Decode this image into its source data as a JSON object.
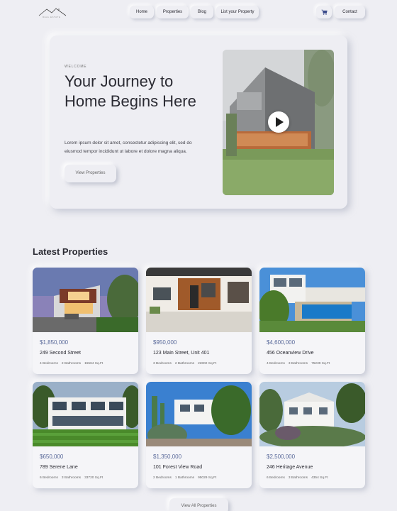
{
  "nav": {
    "logo_text": "REAL ESTATE",
    "links": [
      "Home",
      "Properties",
      "Blog",
      "List your Property"
    ],
    "cart_icon": "cart-icon",
    "contact_label": "Contact"
  },
  "hero": {
    "eyebrow": "WELCOME",
    "title": "Your Journey to Home Begins Here",
    "text": "Lorem ipsum dolor sit amet, consectetur adipiscing elit, sed do eiusmod tempor incididunt ut labore et dolore magna aliqua.",
    "button_label": "View Properties",
    "media_icon": "play-icon"
  },
  "latest": {
    "title": "Latest Properties",
    "view_all_label": "View All Properties",
    "properties": [
      {
        "price": "$1,850,000",
        "address": "249 Second Street",
        "bedrooms": "4 Bedrooms",
        "bathrooms": "2 Bathrooms",
        "area": "15564 Sq.Ft"
      },
      {
        "price": "$950,000",
        "address": "123 Main Street, Unit 401",
        "bedrooms": "3 Bedrooms",
        "bathrooms": "2 Bathrooms",
        "area": "22802 Sq.Ft"
      },
      {
        "price": "$4,600,000",
        "address": "456 Oceanview Drive",
        "bedrooms": "4 Bedrooms",
        "bathrooms": "3 Bathrooms",
        "area": "75239 Sq.Ft"
      },
      {
        "price": "$650,000",
        "address": "789 Serene Lane",
        "bedrooms": "6 Bedrooms",
        "bathrooms": "3 Bathrooms",
        "area": "33720 Sq.Ft"
      },
      {
        "price": "$1,350,000",
        "address": "101 Forest View Road",
        "bedrooms": "2 Bedrooms",
        "bathrooms": "1 Bathrooms",
        "area": "95029 Sq.Ft"
      },
      {
        "price": "$2,500,000",
        "address": "246 Heritage Avenue",
        "bedrooms": "6 Bedrooms",
        "bathrooms": "3 Bathrooms",
        "area": "4354 Sq.Ft"
      }
    ]
  }
}
